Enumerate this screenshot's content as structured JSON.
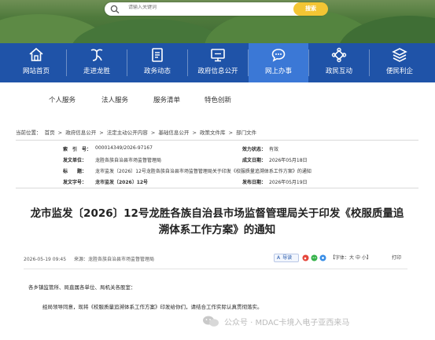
{
  "search": {
    "placeholder": "请输入关键词",
    "button_label": "搜索"
  },
  "nav": {
    "items": [
      {
        "label": "网站首页",
        "icon": "home-icon"
      },
      {
        "label": "走进龙胜",
        "icon": "dragon-icon"
      },
      {
        "label": "政务动态",
        "icon": "document-icon"
      },
      {
        "label": "政府信息公开",
        "icon": "monitor-icon"
      },
      {
        "label": "网上办事",
        "icon": "chat-icon",
        "active": true
      },
      {
        "label": "政民互动",
        "icon": "knot-icon"
      },
      {
        "label": "便民利企",
        "icon": "layers-icon"
      }
    ],
    "active_color": "#3b78d6",
    "bg_color": "#1f53a8"
  },
  "subnav": [
    "个人服务",
    "法人服务",
    "服务清单",
    "特色创新"
  ],
  "breadcrumb": {
    "prefix": "当前位置：",
    "items": [
      "首页",
      "政府信息公开",
      "法定主动公开内容",
      "基础信息公开",
      "政策文件库",
      "部门文件"
    ],
    "separator": ">"
  },
  "meta": {
    "index_label": "索　引　号：",
    "index_value": "000014349/2026-97167",
    "validity_label": "效力状态：",
    "validity_value": "有效",
    "issuer_label": "发文单位：",
    "issuer_value": "龙胜各族自治县市场监督管理局",
    "date_label": "成文日期：",
    "date_value": "2026年05月18日",
    "title_label": "标　　题：",
    "title_value": "龙市监发〔2026〕12号龙胜各族自治县市场监督管理局关于印发《校服质量追溯体系工作方案》的通知",
    "docno_label": "发文字号：",
    "docno_value": "龙市监发〔2026〕12号",
    "pubdate_label": "发布日期：",
    "pubdate_value": "2026年05月19日"
  },
  "article": {
    "title_line1": "龙市监发〔2026〕12号龙胜各族自治县市场监督管理局关于印发《校服质量追",
    "title_line2": "溯体系工作方案》的通知",
    "timestamp": "2026-05-19 09:45",
    "source_label": "来源：",
    "source_value": "龙胜各族自治县市场监督管理局",
    "tts_label": "导读",
    "font_label": "【字体：",
    "font_large": "大",
    "font_medium": "中",
    "font_small": "小",
    "font_close": "】",
    "print_label": "打印",
    "salutation": "各乡镇监管所、局直属各单位、局机关各股室：",
    "paragraph1": "经局领导同意，现将《校服质量追溯体系工作方案》印发给你们，请结合工作实际认真贯彻落实。"
  },
  "watermark": "公众号 · MDAC卡境入电子亚西来马"
}
